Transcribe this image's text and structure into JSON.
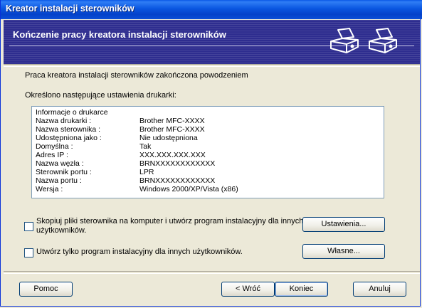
{
  "window": {
    "title": "Kreator instalacji sterowników"
  },
  "banner": {
    "title": "Kończenie pracy kreatora instalacji sterowników"
  },
  "messages": {
    "success": "Praca kreatora instalacji sterowników zakończona powodzeniem",
    "settings_intro": "Określono następujące ustawienia drukarki:"
  },
  "printer_info": {
    "header": "Informacje o drukarce",
    "rows": [
      {
        "key": "Nazwa drukarki :",
        "value": "Brother MFC-XXXX"
      },
      {
        "key": "Nazwa sterownika :",
        "value": "Brother MFC-XXXX"
      },
      {
        "key": "Udostępniona jako :",
        "value": "Nie udostępniona"
      },
      {
        "key": "Domyślna :",
        "value": "Tak"
      },
      {
        "key": "Adres IP :",
        "value": "XXX.XXX.XXX.XXX"
      },
      {
        "key": "Nazwa węzła :",
        "value": "BRNXXXXXXXXXXXX"
      },
      {
        "key": "Sterownik portu :",
        "value": "LPR"
      },
      {
        "key": "Nazwa portu :",
        "value": "BRNXXXXXXXXXXXX"
      },
      {
        "key": "Wersja :",
        "value": "Windows 2000/XP/Vista (x86)"
      }
    ]
  },
  "options": {
    "copy_files": {
      "line1": "Skopiuj pliki sterownika na komputer i utwórz program instalacyjny dla innych",
      "line2": "użytkowników.",
      "checked": false
    },
    "installer_only": {
      "label": "Utwórz tylko program instalacyjny dla innych użytkowników.",
      "checked": false
    }
  },
  "buttons": {
    "settings": "Ustawienia...",
    "custom": "Własne...",
    "help": "Pomoc",
    "back": "< Wróć",
    "finish": "Koniec",
    "cancel": "Anuluj"
  }
}
